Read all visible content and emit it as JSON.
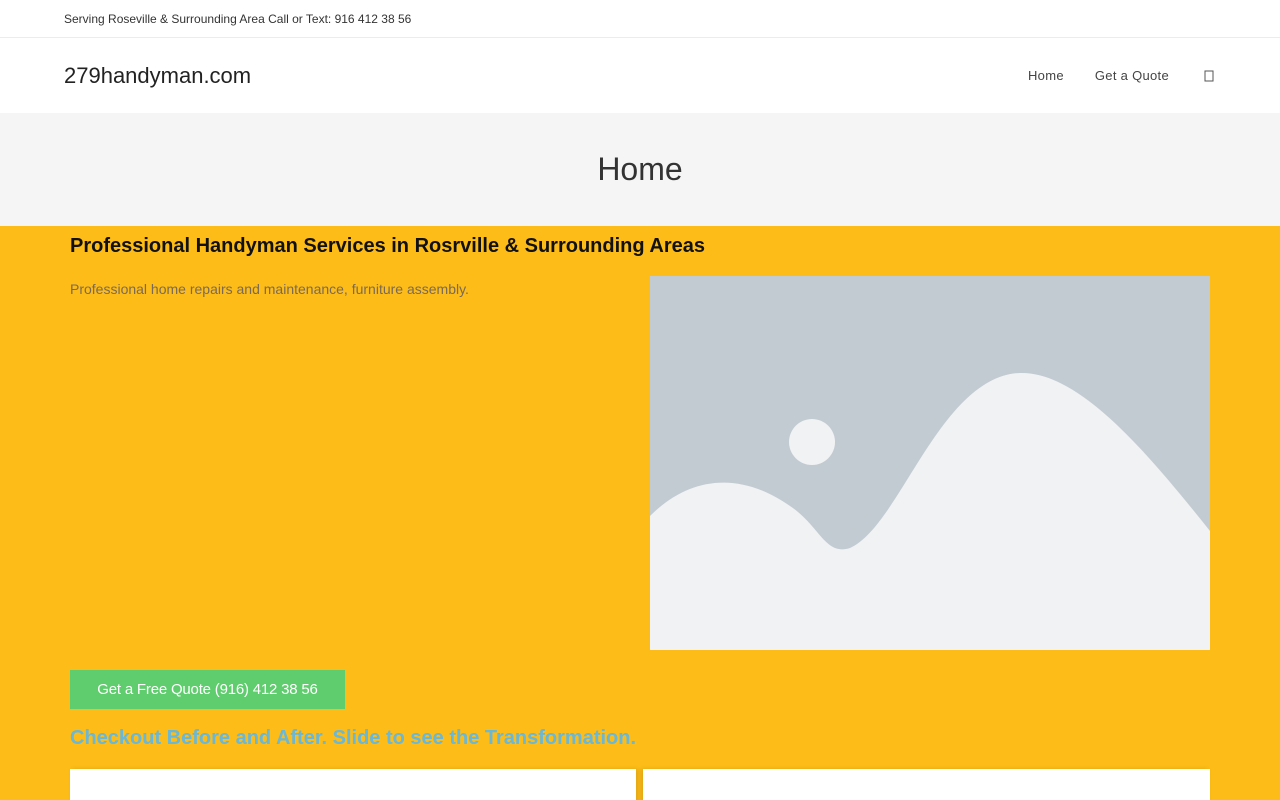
{
  "topbar": {
    "text": "Serving Roseville & Surrounding Area Call or Text: 916 412 38 56"
  },
  "header": {
    "logo": "279handyman.com",
    "nav": [
      {
        "label": "Home"
      },
      {
        "label": "Get a Quote"
      }
    ],
    "search_icon": "search-icon"
  },
  "page_header": {
    "title": "Home"
  },
  "hero": {
    "title": "Professional Handyman Services in Rosrville & Surrounding Areas",
    "description": "Professional home repairs and maintenance, furniture assembly.",
    "image_icon": "image-placeholder-icon",
    "button_label": "Get a Free Quote (916) 412 38 56",
    "slider_heading": "Checkout Before and After. Slide to see the Transformation."
  },
  "colors": {
    "hero_background": "#fdbc17",
    "button": "#5fcc6e",
    "slider_heading": "#6ab7d6",
    "page_header_bg": "#f5f5f5"
  }
}
